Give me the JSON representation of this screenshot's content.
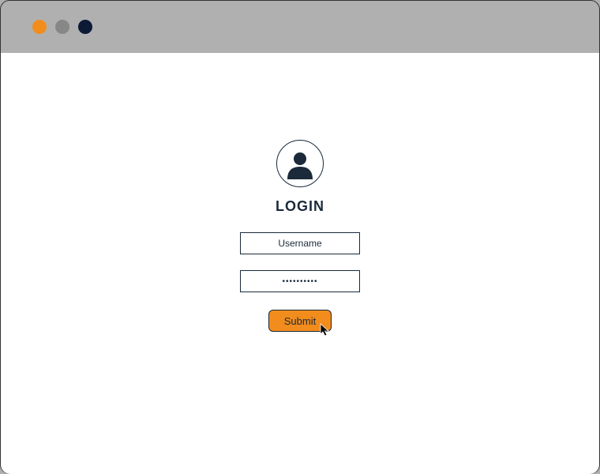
{
  "titlebar": {
    "dot_colors": {
      "close": "#f28c1c",
      "minimize": "#878787",
      "maximize": "#0c1a36"
    }
  },
  "login": {
    "title": "LOGIN",
    "username_placeholder": "Username",
    "password_mask": "••••••••••",
    "submit_label": "Submit"
  },
  "colors": {
    "accent": "#f28c1c",
    "ink": "#1a2a3a",
    "chrome": "#b0b0b0",
    "content_bg": "#ffffff"
  }
}
